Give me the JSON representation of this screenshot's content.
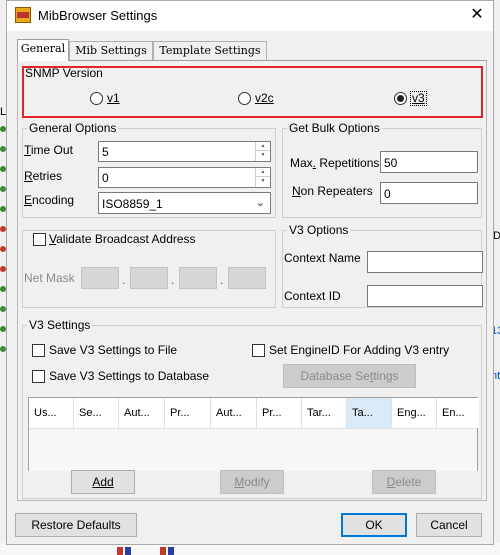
{
  "window": {
    "title": "MibBrowser Settings",
    "close_label": "✕"
  },
  "tabs": [
    {
      "label": "General",
      "active": true
    },
    {
      "label": "Mib Settings",
      "active": false
    },
    {
      "label": "Template Settings",
      "active": false
    }
  ],
  "snmp_version": {
    "legend": "SNMP Version",
    "options": [
      {
        "label": "v1",
        "checked": false
      },
      {
        "label": "v2c",
        "checked": false
      },
      {
        "label": "v3",
        "checked": true
      }
    ],
    "highlight_color": "#e2232a"
  },
  "general_options": {
    "legend": "General Options",
    "timeout_label": "Time Out",
    "timeout_value": "5",
    "retries_label": "Retries",
    "retries_value": "0",
    "encoding_label": "Encoding",
    "encoding_value": "ISO8859_1"
  },
  "get_bulk": {
    "legend": "Get Bulk Options",
    "max_rep_label": "Max. Repetitions",
    "max_rep_value": "50",
    "non_rep_label": "Non Repeaters",
    "non_rep_value": "0"
  },
  "broadcast": {
    "checkbox_label": "Validate Broadcast Address",
    "checked": false,
    "netmask_label": "Net Mask",
    "dot": "."
  },
  "v3_options": {
    "legend": "V3 Options",
    "context_name_label": "Context Name",
    "context_name_value": "",
    "context_id_label": "Context ID",
    "context_id_value": ""
  },
  "v3_settings": {
    "legend": "V3 Settings",
    "save_file_label": "Save V3 Settings to File",
    "save_file_checked": false,
    "save_db_label": "Save V3 Settings to Database",
    "save_db_checked": false,
    "engine_id_label": "Set EngineID For Adding V3 entry",
    "engine_id_checked": false,
    "db_settings_button": "Database Settings",
    "table_headers": [
      "Us...",
      "Se...",
      "Aut...",
      "Pr...",
      "Aut...",
      "Pr...",
      "Tar...",
      "Ta...",
      "Eng...",
      "En..."
    ],
    "selected_header_index": 7,
    "add_button": "Add",
    "modify_button": "Modify",
    "delete_button": "Delete"
  },
  "footer": {
    "restore_button": "Restore Defaults",
    "ok_button": "OK",
    "cancel_button": "Cancel"
  },
  "background_text": {
    "right_fragment_1": "D",
    "right_fragment_2": "13",
    "right_fragment_3": "nt",
    "left_fragment": "Lo"
  }
}
